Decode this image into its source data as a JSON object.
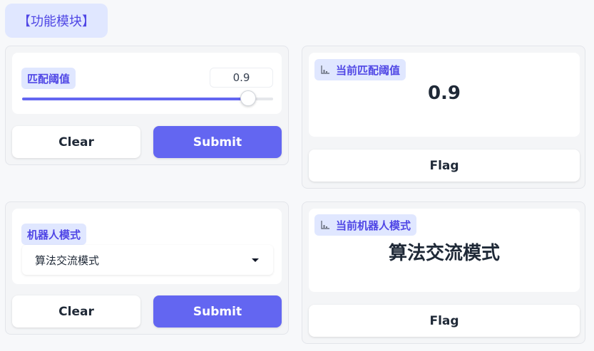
{
  "tab": {
    "label": "【功能模块】"
  },
  "threshold_input": {
    "label": "匹配阈值",
    "value": "0.9",
    "slider_fraction": 0.9,
    "clear_label": "Clear",
    "submit_label": "Submit"
  },
  "threshold_output": {
    "label": "当前匹配阈值",
    "value": "0.9",
    "flag_label": "Flag",
    "icon": "bar-chart-icon"
  },
  "mode_input": {
    "label": "机器人模式",
    "selected": "算法交流模式",
    "clear_label": "Clear",
    "submit_label": "Submit"
  },
  "mode_output": {
    "label": "当前机器人模式",
    "value": "算法交流模式",
    "flag_label": "Flag",
    "icon": "bar-chart-icon"
  },
  "colors": {
    "accent": "#6366f1",
    "chip_bg": "#e0e7ff",
    "chip_text": "#4f46e5"
  }
}
